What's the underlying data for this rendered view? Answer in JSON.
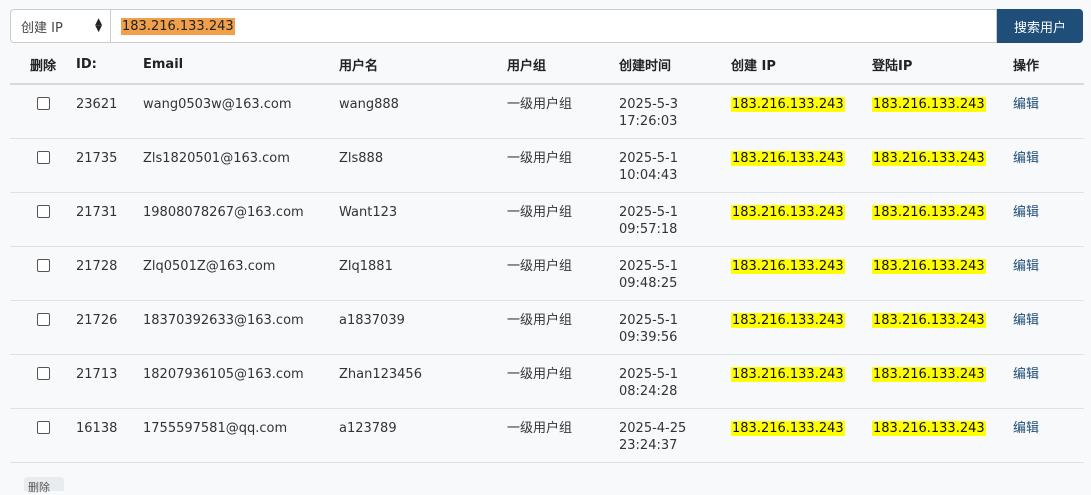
{
  "search": {
    "select_value": "创建 IP",
    "input_value": "183.216.133.243",
    "button_label": "搜索用户"
  },
  "table": {
    "headers": {
      "delete": "删除",
      "id": "ID:",
      "email": "Email",
      "username": "用户名",
      "group": "用户组",
      "created_time": "创建时间",
      "created_ip": "创建 IP",
      "login_ip": "登陆IP",
      "action": "操作"
    },
    "rows": [
      {
        "id": "23621",
        "email": "wang0503w@163.com",
        "username": "wang888",
        "group": "一级用户组",
        "date": "2025-5-3",
        "time": "17:26:03",
        "created_ip": "183.216.133.243",
        "login_ip": "183.216.133.243",
        "action": "编辑"
      },
      {
        "id": "21735",
        "email": "Zls1820501@163.com",
        "username": "Zls888",
        "group": "一级用户组",
        "date": "2025-5-1",
        "time": "10:04:43",
        "created_ip": "183.216.133.243",
        "login_ip": "183.216.133.243",
        "action": "编辑"
      },
      {
        "id": "21731",
        "email": "19808078267@163.com",
        "username": "Want123",
        "group": "一级用户组",
        "date": "2025-5-1",
        "time": "09:57:18",
        "created_ip": "183.216.133.243",
        "login_ip": "183.216.133.243",
        "action": "编辑"
      },
      {
        "id": "21728",
        "email": "Zlq0501Z@163.com",
        "username": "Zlq1881",
        "group": "一级用户组",
        "date": "2025-5-1",
        "time": "09:48:25",
        "created_ip": "183.216.133.243",
        "login_ip": "183.216.133.243",
        "action": "编辑"
      },
      {
        "id": "21726",
        "email": "18370392633@163.com",
        "username": "a1837039",
        "group": "一级用户组",
        "date": "2025-5-1",
        "time": "09:39:56",
        "created_ip": "183.216.133.243",
        "login_ip": "183.216.133.243",
        "action": "编辑"
      },
      {
        "id": "21713",
        "email": "18207936105@163.com",
        "username": "Zhan123456",
        "group": "一级用户组",
        "date": "2025-5-1",
        "time": "08:24:28",
        "created_ip": "183.216.133.243",
        "login_ip": "183.216.133.243",
        "action": "编辑"
      },
      {
        "id": "16138",
        "email": "1755597581@qq.com",
        "username": "a123789",
        "group": "一级用户组",
        "date": "2025-4-25",
        "time": "23:24:37",
        "created_ip": "183.216.133.243",
        "login_ip": "183.216.133.243",
        "action": "编辑"
      }
    ]
  },
  "footer": {
    "delete_button": "删除"
  },
  "colors": {
    "button_bg": "#1f4e79",
    "highlight": "#ffff00",
    "input_selection": "#f0a04a"
  }
}
